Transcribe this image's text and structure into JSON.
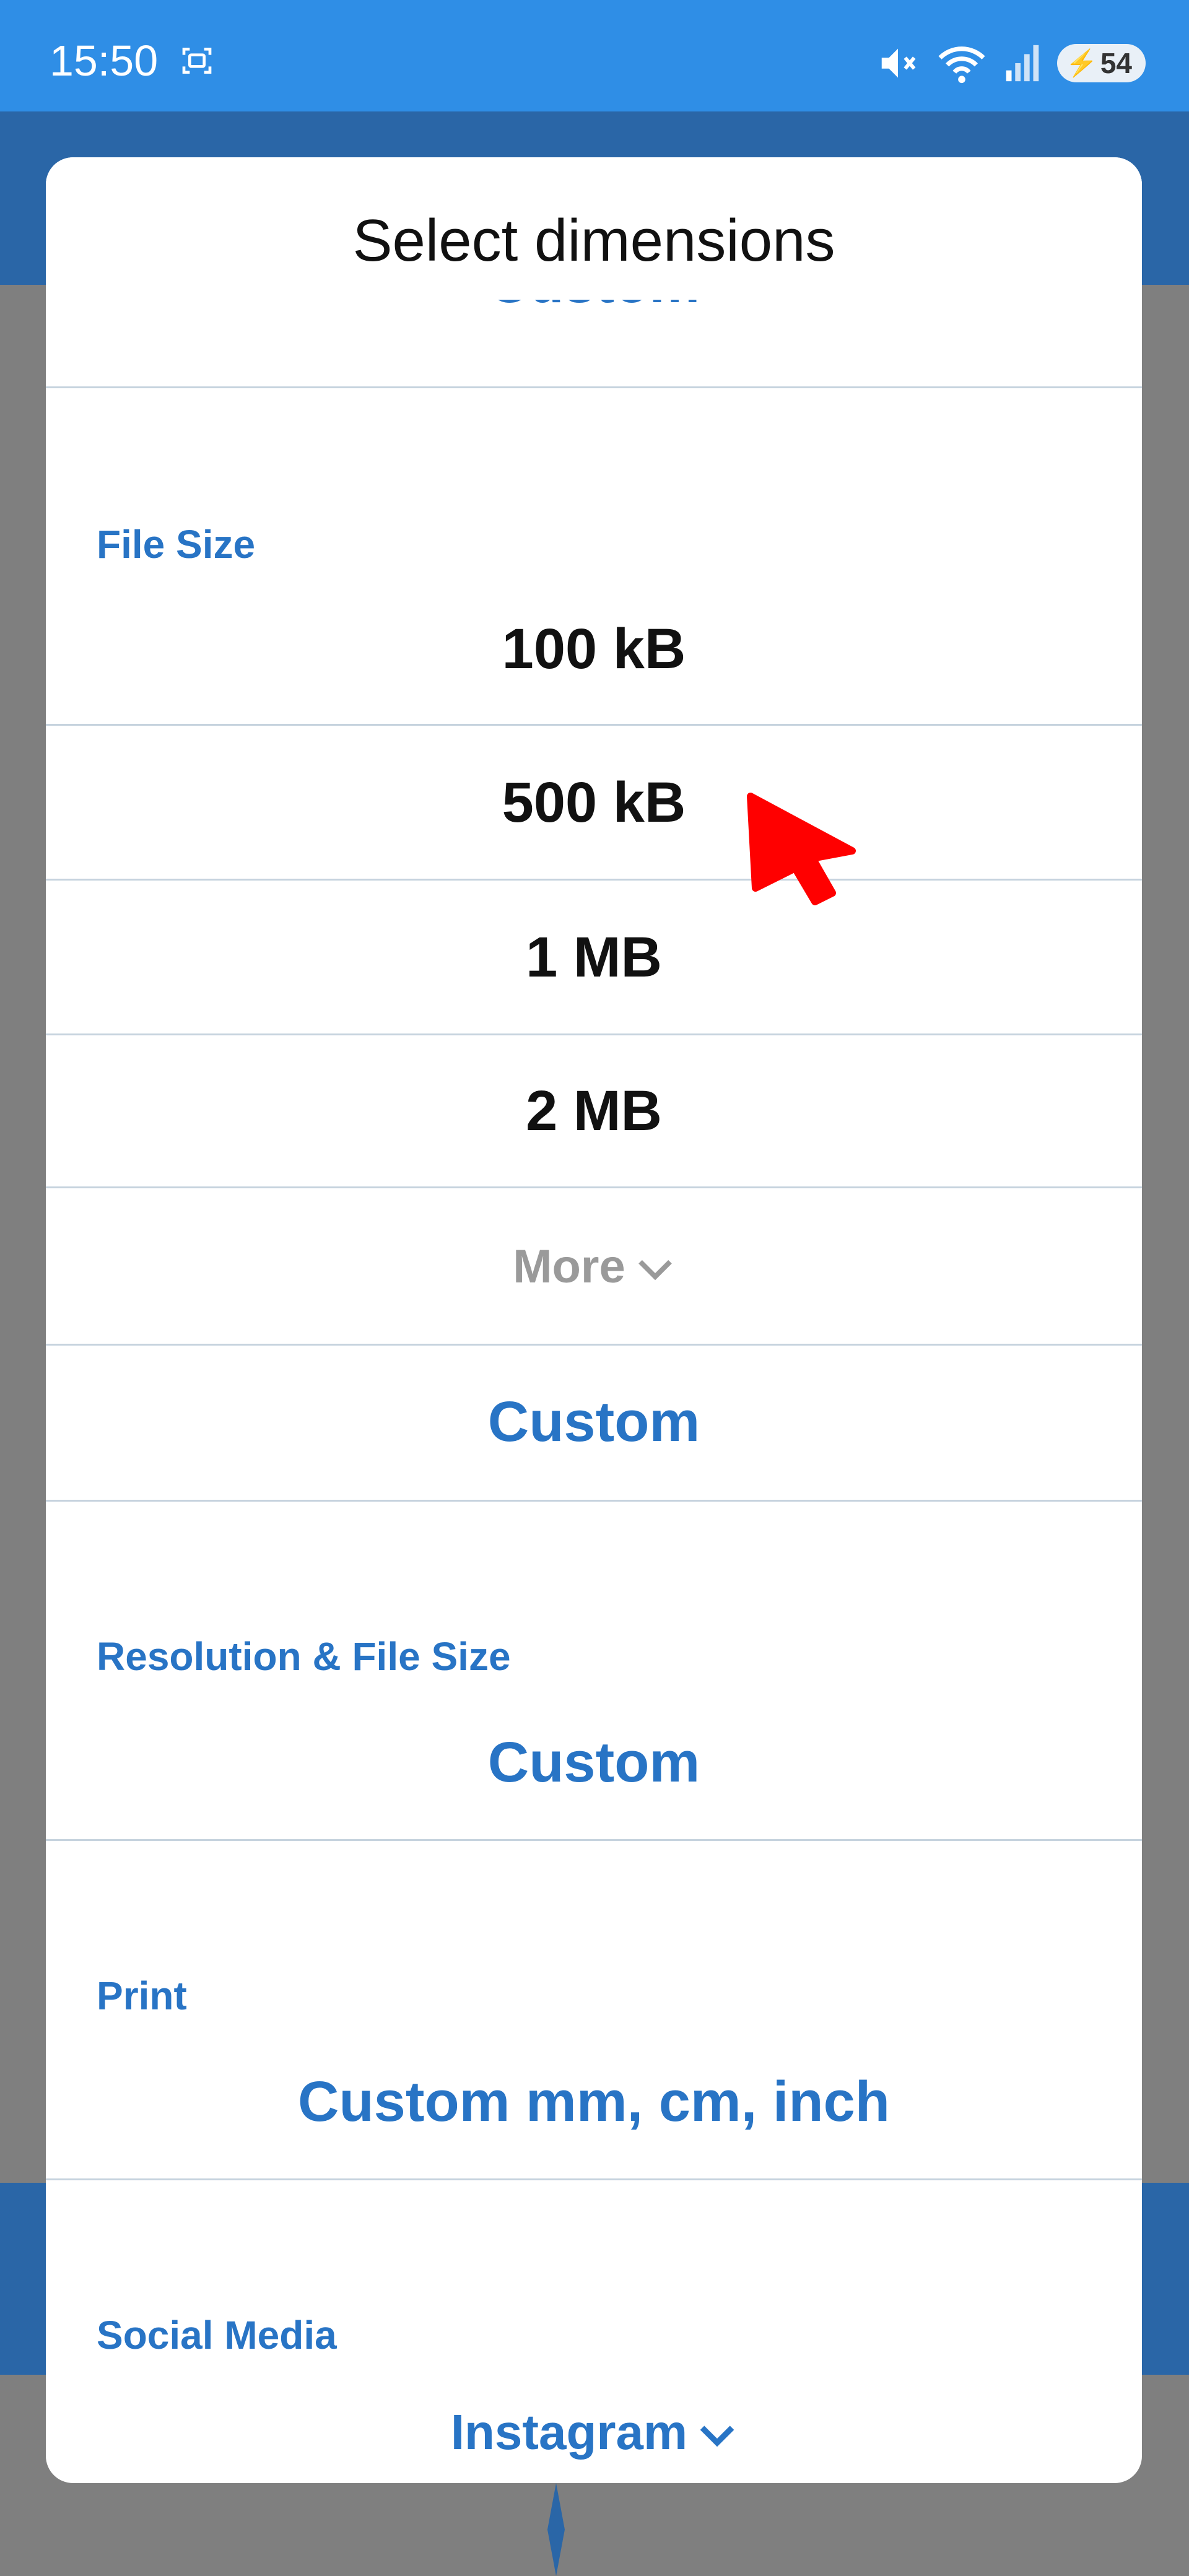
{
  "status_bar": {
    "time": "15:50",
    "battery": "54",
    "icons": [
      "screenshot-icon",
      "mute-icon",
      "wifi-icon",
      "signal-icon",
      "battery-icon"
    ]
  },
  "dialog": {
    "title": "Select dimensions",
    "clipped_option": "Custom",
    "sections": [
      {
        "label": "File Size",
        "options": [
          "100 kB",
          "500 kB",
          "1 MB",
          "2 MB"
        ],
        "more_label": "More",
        "custom_label": "Custom"
      },
      {
        "label": "Resolution & File Size",
        "custom_label": "Custom"
      },
      {
        "label": "Print",
        "custom_label": "Custom mm, cm, inch"
      },
      {
        "label": "Social Media",
        "dropdown_label": "Instagram"
      }
    ]
  },
  "colors": {
    "status_bar": "#2f8ee6",
    "app_bar": "#2a66a7",
    "accent": "#2874c5",
    "scrim": "#7f7f7f",
    "cursor": "#ff0000"
  }
}
